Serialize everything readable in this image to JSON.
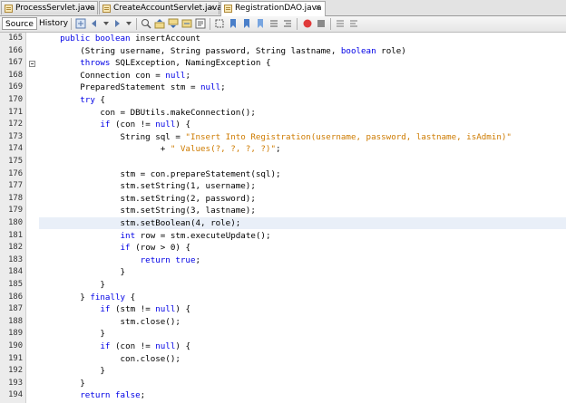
{
  "tabs": [
    {
      "label": "ProcessServlet.java",
      "close": "×",
      "active": false
    },
    {
      "label": "CreateAccountServlet.java",
      "close": "×",
      "active": false
    },
    {
      "label": "RegistrationDAO.java",
      "close": "×",
      "active": true
    }
  ],
  "toolbar": {
    "source_label": "Source",
    "history_label": "History"
  },
  "colors": {
    "keyword": "#0000e6",
    "string": "#ce7b00",
    "current_line": "#e9eff8"
  },
  "editor": {
    "current_line": 180,
    "lines": [
      {
        "n": "165",
        "segs": [
          [
            "    ",
            ""
          ],
          [
            "public boolean",
            "kw"
          ],
          [
            " insertAccount",
            ""
          ]
        ]
      },
      {
        "n": "166",
        "segs": [
          [
            "        (String username, String password, String lastname, ",
            ""
          ],
          [
            "boolean",
            "kw"
          ],
          [
            " role)",
            ""
          ]
        ]
      },
      {
        "n": "167",
        "segs": [
          [
            "        ",
            ""
          ],
          [
            "throws",
            "kw"
          ],
          [
            " SQLException, NamingException {",
            ""
          ]
        ]
      },
      {
        "n": "168",
        "segs": [
          [
            "        Connection con = ",
            ""
          ],
          [
            "null",
            "kw"
          ],
          [
            ";",
            ""
          ]
        ]
      },
      {
        "n": "169",
        "segs": [
          [
            "        PreparedStatement stm = ",
            ""
          ],
          [
            "null",
            "kw"
          ],
          [
            ";",
            ""
          ]
        ]
      },
      {
        "n": "170",
        "segs": [
          [
            "        ",
            ""
          ],
          [
            "try",
            "kw"
          ],
          [
            " {",
            ""
          ]
        ]
      },
      {
        "n": "171",
        "segs": [
          [
            "            con = DBUtils.makeConnection();",
            ""
          ]
        ]
      },
      {
        "n": "172",
        "segs": [
          [
            "            ",
            ""
          ],
          [
            "if",
            "kw"
          ],
          [
            " (con != ",
            ""
          ],
          [
            "null",
            "kw"
          ],
          [
            ") {",
            ""
          ]
        ]
      },
      {
        "n": "173",
        "segs": [
          [
            "                String sql = ",
            ""
          ],
          [
            "\"Insert Into Registration(username, password, lastname, isAdmin)\"",
            "str"
          ]
        ]
      },
      {
        "n": "174",
        "segs": [
          [
            "                        + ",
            ""
          ],
          [
            "\" Values(?, ?, ?, ?)\"",
            "str"
          ],
          [
            ";",
            ""
          ]
        ]
      },
      {
        "n": "175",
        "segs": [
          [
            "",
            ""
          ]
        ]
      },
      {
        "n": "176",
        "segs": [
          [
            "                stm = con.prepareStatement(sql);",
            ""
          ]
        ]
      },
      {
        "n": "177",
        "segs": [
          [
            "                stm.setString(1, username);",
            ""
          ]
        ]
      },
      {
        "n": "178",
        "segs": [
          [
            "                stm.setString(2, password);",
            ""
          ]
        ]
      },
      {
        "n": "179",
        "segs": [
          [
            "                stm.setString(3, lastname);",
            ""
          ]
        ]
      },
      {
        "n": "180",
        "segs": [
          [
            "                stm.setBoolean(4, role);",
            ""
          ]
        ]
      },
      {
        "n": "181",
        "segs": [
          [
            "                ",
            ""
          ],
          [
            "int",
            "kw"
          ],
          [
            " row = stm.executeUpdate();",
            ""
          ]
        ]
      },
      {
        "n": "182",
        "segs": [
          [
            "                ",
            ""
          ],
          [
            "if",
            "kw"
          ],
          [
            " (row > 0) {",
            ""
          ]
        ]
      },
      {
        "n": "183",
        "segs": [
          [
            "                    ",
            ""
          ],
          [
            "return true",
            "kw"
          ],
          [
            ";",
            ""
          ]
        ]
      },
      {
        "n": "184",
        "segs": [
          [
            "                }",
            ""
          ]
        ]
      },
      {
        "n": "185",
        "segs": [
          [
            "            }",
            ""
          ]
        ]
      },
      {
        "n": "186",
        "segs": [
          [
            "        } ",
            ""
          ],
          [
            "finally",
            "kw"
          ],
          [
            " {",
            ""
          ]
        ]
      },
      {
        "n": "187",
        "segs": [
          [
            "            ",
            ""
          ],
          [
            "if",
            "kw"
          ],
          [
            " (stm != ",
            ""
          ],
          [
            "null",
            "kw"
          ],
          [
            ") {",
            ""
          ]
        ]
      },
      {
        "n": "188",
        "segs": [
          [
            "                stm.close();",
            ""
          ]
        ]
      },
      {
        "n": "189",
        "segs": [
          [
            "            }",
            ""
          ]
        ]
      },
      {
        "n": "190",
        "segs": [
          [
            "            ",
            ""
          ],
          [
            "if",
            "kw"
          ],
          [
            " (con != ",
            ""
          ],
          [
            "null",
            "kw"
          ],
          [
            ") {",
            ""
          ]
        ]
      },
      {
        "n": "191",
        "segs": [
          [
            "                con.close();",
            ""
          ]
        ]
      },
      {
        "n": "192",
        "segs": [
          [
            "            }",
            ""
          ]
        ]
      },
      {
        "n": "193",
        "segs": [
          [
            "        }",
            ""
          ]
        ]
      },
      {
        "n": "194",
        "segs": [
          [
            "        ",
            ""
          ],
          [
            "return false",
            "kw"
          ],
          [
            ";",
            ""
          ]
        ]
      }
    ]
  }
}
